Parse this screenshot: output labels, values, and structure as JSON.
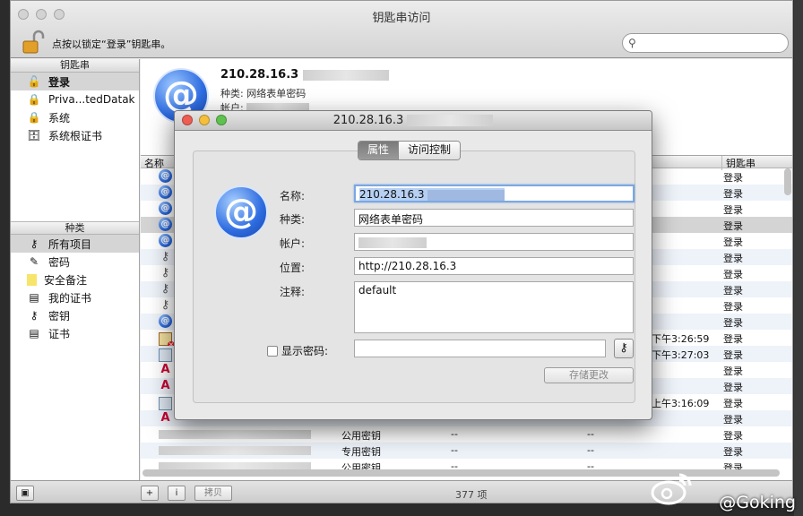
{
  "window": {
    "title": "钥匙串访问",
    "lock_text": "点按以锁定“登录”钥匙串。",
    "search_placeholder": ""
  },
  "sidebar": {
    "keychains_header": "钥匙串",
    "keychains": [
      {
        "label": "登录",
        "icon": "lock-open-icon",
        "selected": true
      },
      {
        "label": "Priva...tedDatak",
        "icon": "lock-icon",
        "selected": false
      },
      {
        "label": "系统",
        "icon": "lock-icon",
        "selected": false
      },
      {
        "label": "系统根证书",
        "icon": "cabinet-icon",
        "selected": false
      }
    ],
    "categories_header": "种类",
    "categories": [
      {
        "label": "所有项目",
        "icon": "all-items-icon",
        "selected": true
      },
      {
        "label": "密码",
        "icon": "password-icon",
        "selected": false
      },
      {
        "label": "安全备注",
        "icon": "note-icon",
        "selected": false
      },
      {
        "label": "我的证书",
        "icon": "my-cert-icon",
        "selected": false
      },
      {
        "label": "密钥",
        "icon": "key-icon",
        "selected": false
      },
      {
        "label": "证书",
        "icon": "cert-icon",
        "selected": false
      }
    ]
  },
  "detail": {
    "name": "210.28.16.3",
    "kind_label": "种类:",
    "kind_value": "网络表单密码",
    "account_label": "帐户:"
  },
  "list": {
    "col_name": "名称",
    "col_keychain": "钥匙串",
    "rows": [
      {
        "icon": "at",
        "date": "",
        "keychain": "登录"
      },
      {
        "icon": "at",
        "date": "",
        "keychain": "登录"
      },
      {
        "icon": "at",
        "date": "",
        "keychain": "登录"
      },
      {
        "icon": "at",
        "date": "",
        "keychain": "登录",
        "selected": true
      },
      {
        "icon": "at",
        "date": "",
        "keychain": "登录"
      },
      {
        "icon": "key",
        "date": "",
        "keychain": "登录"
      },
      {
        "icon": "key",
        "date": "",
        "keychain": "登录"
      },
      {
        "icon": "key",
        "date": "",
        "keychain": "登录"
      },
      {
        "icon": "key",
        "date": "",
        "keychain": "登录"
      },
      {
        "icon": "at",
        "date": "",
        "keychain": "登录"
      },
      {
        "icon": "certx",
        "date": "下午3:26:59",
        "keychain": "登录"
      },
      {
        "icon": "cert",
        "date": "下午3:27:03",
        "keychain": "登录"
      },
      {
        "icon": "app",
        "date": "",
        "keychain": "登录"
      },
      {
        "icon": "app",
        "date": "",
        "keychain": "登录"
      },
      {
        "icon": "cert",
        "date": "上午3:16:09",
        "keychain": "登录"
      },
      {
        "icon": "app",
        "date": "",
        "keychain": "登录"
      },
      {
        "icon": "blur",
        "kind": "公用密钥",
        "mod": "--",
        "cre": "--",
        "keychain": "登录"
      },
      {
        "icon": "blur",
        "kind": "专用密钥",
        "mod": "--",
        "cre": "--",
        "keychain": "登录"
      },
      {
        "icon": "blur",
        "kind": "公用密钥",
        "mod": "--",
        "cre": "--",
        "keychain": "登录"
      }
    ]
  },
  "bottom": {
    "add_label": "+",
    "info_label": "i",
    "copy_label": "拷贝",
    "count": "377 项"
  },
  "dialog": {
    "title": "210.28.16.3",
    "tab_attributes": "属性",
    "tab_access": "访问控制",
    "name_label": "名称:",
    "name_value": "210.28.16.3",
    "kind_label": "种类:",
    "kind_value": "网络表单密码",
    "account_label": "帐户:",
    "account_value": "",
    "where_label": "位置:",
    "where_value": "http://210.28.16.3",
    "comments_label": "注释:",
    "comments_value": "default",
    "show_password_label": "显示密码:",
    "save_label": "存储更改"
  },
  "watermark": "@Goking",
  "colors": {
    "close": "#ee5d52",
    "minimize": "#f5bf3c",
    "zoom": "#5fc24f",
    "selection": "#b6d0f3"
  }
}
